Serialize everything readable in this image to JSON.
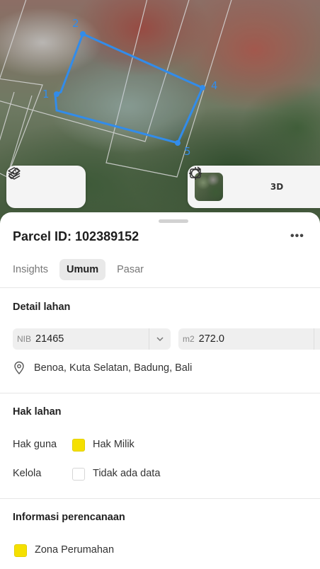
{
  "map": {
    "vertex_labels": [
      "2",
      "1",
      "4",
      "5"
    ],
    "accent_color": "#2e8df0"
  },
  "map_controls": {
    "layers_icon": "layers-icon",
    "draw_icon": "measure-icon",
    "locate_icon": "crosshair-icon",
    "three_d_label": "3D",
    "rotate_icon": "rotate-icon"
  },
  "sheet": {
    "title": "Parcel ID: 102389152",
    "more_label": "•••",
    "tabs": [
      {
        "label": "Insights",
        "active": false
      },
      {
        "label": "Umum",
        "active": true
      },
      {
        "label": "Pasar",
        "active": false
      }
    ],
    "land_detail": {
      "title": "Detail lahan",
      "nib_prefix": "NIB",
      "nib_value": "21465",
      "area_prefix": "m2",
      "area_value": "272.0",
      "location": "Benoa, Kuta Selatan, Badung, Bali"
    },
    "land_rights": {
      "title": "Hak lahan",
      "rows": [
        {
          "label": "Hak guna",
          "value": "Hak Milik",
          "swatch_color": "#f5e000"
        },
        {
          "label": "Kelola",
          "value": "Tidak ada data",
          "swatch_color": "#ffffff"
        }
      ]
    },
    "planning": {
      "title": "Informasi perencanaan",
      "zone_label": "Zona Perumahan",
      "zone_color": "#f5e000"
    }
  }
}
